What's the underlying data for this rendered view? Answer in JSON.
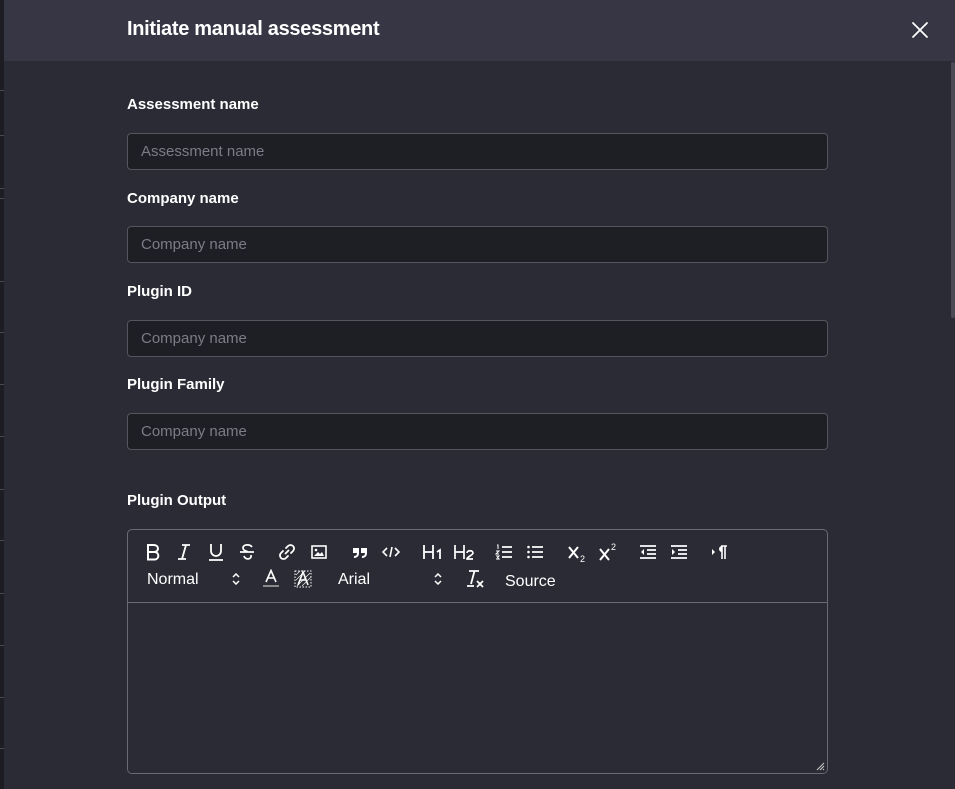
{
  "modal": {
    "title": "Initiate manual assessment",
    "close_icon": "close-icon"
  },
  "fields": [
    {
      "label": "Assessment name",
      "placeholder": "Assessment name",
      "value": ""
    },
    {
      "label": "Company name",
      "placeholder": "Company name",
      "value": ""
    },
    {
      "label": "Plugin ID",
      "placeholder": "Company name",
      "value": ""
    },
    {
      "label": "Plugin Family",
      "placeholder": "Company name",
      "value": ""
    }
  ],
  "plugin_output": {
    "label": "Plugin Output",
    "toolbar": {
      "row1_icons": [
        "bold-icon",
        "italic-icon",
        "underline-icon",
        "strikethrough-icon",
        "link-icon",
        "image-icon",
        "blockquote-icon",
        "code-block-icon",
        "header-1-icon",
        "header-2-icon",
        "ordered-list-icon",
        "bullet-list-icon",
        "subscript-icon",
        "superscript-icon",
        "outdent-icon",
        "indent-icon",
        "text-direction-icon"
      ],
      "size_picker": "Normal",
      "font_picker": "Arial",
      "source_label": "Source",
      "row2_icons": [
        "text-color-icon",
        "background-color-icon",
        "clear-format-icon"
      ]
    },
    "content": ""
  }
}
